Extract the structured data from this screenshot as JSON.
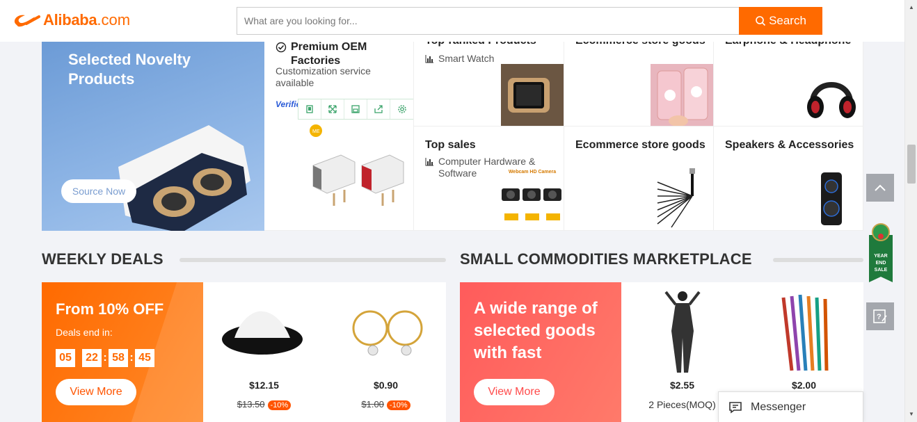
{
  "header": {
    "logo_text": "Alibaba",
    "logo_suffix": ".com",
    "search_placeholder": "What are you looking for...",
    "search_button": "Search"
  },
  "promo": {
    "title": "Selected Novelty Products",
    "button": "Source Now"
  },
  "cards": {
    "oem": {
      "title_line1": "Premium OEM",
      "title_line2": "Factories",
      "desc": "Customization service available",
      "verified": "Verified"
    },
    "top_ranked": {
      "title": "Top-ranked Products",
      "sub": "Smart Watch"
    },
    "ecom1": {
      "title": "Ecommerce store goods"
    },
    "earphone": {
      "title": "Earphone & Headphone"
    },
    "top_sales": {
      "title": "Top sales",
      "sub": "Computer Hardware & Software",
      "img_label": "Webcam HD Camera"
    },
    "ecom2": {
      "title": "Ecommerce store goods"
    },
    "speakers": {
      "title": "Speakers & Accessories"
    }
  },
  "weekly": {
    "heading": "WEEKLY DEALS",
    "promo_title": "From 10% OFF",
    "ends_label": "Deals end in:",
    "timer": [
      "05",
      "22",
      "58",
      "45"
    ],
    "button": "View More",
    "products": [
      {
        "price": "$12.15",
        "old": "$13.50",
        "discount": "-10%"
      },
      {
        "price": "$0.90",
        "old": "$1.00",
        "discount": "-10%"
      }
    ]
  },
  "small": {
    "heading": "SMALL COMMODITIES MARKETPLACE",
    "promo_title": "A wide range of selected goods with fast",
    "button": "View More",
    "products": [
      {
        "price": "$2.55",
        "moq": "2 Pieces(MOQ)"
      },
      {
        "price": "$2.00"
      }
    ]
  },
  "floating": {
    "badge_text": "YEAR END SALE",
    "messenger": "Messenger"
  },
  "colors": {
    "brand": "#ff6a00",
    "deal_red": "#ff5b5b",
    "promo_blue": "#7ea7dd"
  }
}
